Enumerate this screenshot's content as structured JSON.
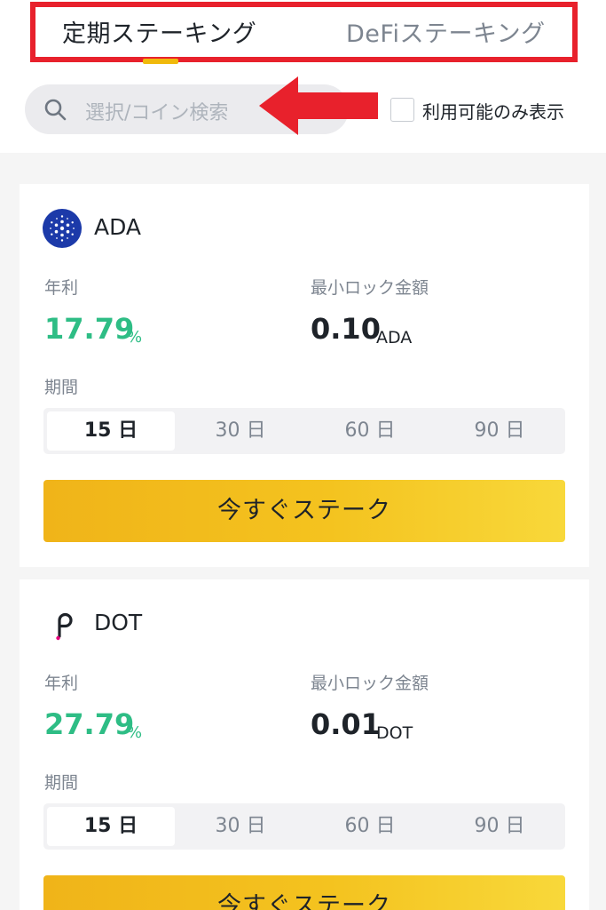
{
  "tabs": {
    "active": "定期ステーキング",
    "inactive": "DeFiステーキング"
  },
  "search": {
    "placeholder": "選択/コイン検索"
  },
  "filter": {
    "label": "利用可能のみ表示"
  },
  "labels": {
    "apr": "年利",
    "min_lock": "最小ロック金額",
    "period": "期間",
    "stake_button": "今すぐステーク"
  },
  "products": [
    {
      "coin": "ADA",
      "apr_value": "17.79",
      "apr_unit": "%",
      "min_value": "0.10",
      "min_unit": "ADA",
      "periods": [
        "15 日",
        "30 日",
        "60 日",
        "90 日"
      ],
      "selected_period": "15 日"
    },
    {
      "coin": "DOT",
      "apr_value": "27.79",
      "apr_unit": "%",
      "min_value": "0.01",
      "min_unit": "DOT",
      "periods": [
        "15 日",
        "30 日",
        "60 日",
        "90 日"
      ],
      "selected_period": "15 日"
    }
  ],
  "colors": {
    "accent": "#f0b90b",
    "positive": "#2ebd85",
    "highlight": "#e8212c"
  },
  "icons": {
    "search": "search-icon",
    "ada": "cardano-logo-icon",
    "dot": "polkadot-logo-icon",
    "annotation": "red-arrow-icon"
  }
}
